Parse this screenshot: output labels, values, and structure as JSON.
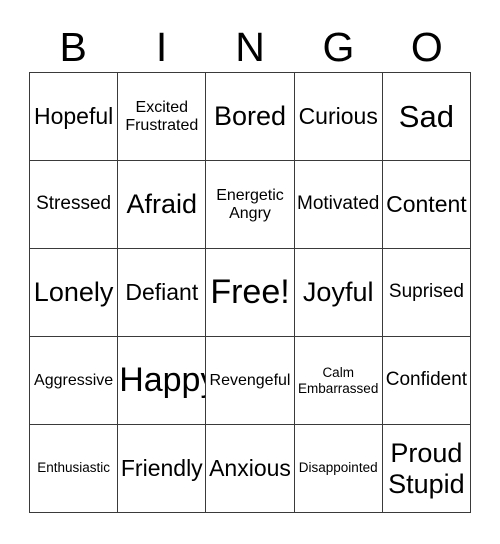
{
  "card": {
    "title": "BINGO",
    "header_letters": [
      "B",
      "I",
      "N",
      "G",
      "O"
    ],
    "grid": {
      "rows": 5,
      "columns": 5,
      "border_color": "#3a3a3a",
      "background_color": "#ffffff",
      "text_color": "#000000"
    },
    "cells": [
      {
        "lines": [
          "Hopeful"
        ],
        "size": "fs-md"
      },
      {
        "lines": [
          "Excited",
          "Frustrated"
        ],
        "size": "fs-xs"
      },
      {
        "lines": [
          "Bored"
        ],
        "size": "fs-lg"
      },
      {
        "lines": [
          "Curious"
        ],
        "size": "fs-md"
      },
      {
        "lines": [
          "Sad"
        ],
        "size": "fs-xl"
      },
      {
        "lines": [
          "Stressed"
        ],
        "size": "fs-sm"
      },
      {
        "lines": [
          "Afraid"
        ],
        "size": "fs-lg"
      },
      {
        "lines": [
          "Energetic",
          "Angry"
        ],
        "size": "fs-xs"
      },
      {
        "lines": [
          "Motivated"
        ],
        "size": "fs-sm"
      },
      {
        "lines": [
          "Content"
        ],
        "size": "fs-md"
      },
      {
        "lines": [
          "Lonely"
        ],
        "size": "fs-lg"
      },
      {
        "lines": [
          "Defiant"
        ],
        "size": "fs-md"
      },
      {
        "lines": [
          "Free!"
        ],
        "size": "fs-xxl"
      },
      {
        "lines": [
          "Joyful"
        ],
        "size": "fs-lg"
      },
      {
        "lines": [
          "Suprised"
        ],
        "size": "fs-sm"
      },
      {
        "lines": [
          "Aggressive"
        ],
        "size": "fs-xs"
      },
      {
        "lines": [
          "Happy"
        ],
        "size": "fs-xxl"
      },
      {
        "lines": [
          "Revengeful"
        ],
        "size": "fs-xs"
      },
      {
        "lines": [
          "Calm",
          "Embarrassed"
        ],
        "size": "fs-xxs"
      },
      {
        "lines": [
          "Confident"
        ],
        "size": "fs-sm"
      },
      {
        "lines": [
          "Enthusiastic"
        ],
        "size": "fs-xxs"
      },
      {
        "lines": [
          "Friendly"
        ],
        "size": "fs-md"
      },
      {
        "lines": [
          "Anxious"
        ],
        "size": "fs-md"
      },
      {
        "lines": [
          "Disappointed"
        ],
        "size": "fs-xxs"
      },
      {
        "lines": [
          "Proud",
          "Stupid"
        ],
        "size": "fs-lg"
      }
    ]
  }
}
